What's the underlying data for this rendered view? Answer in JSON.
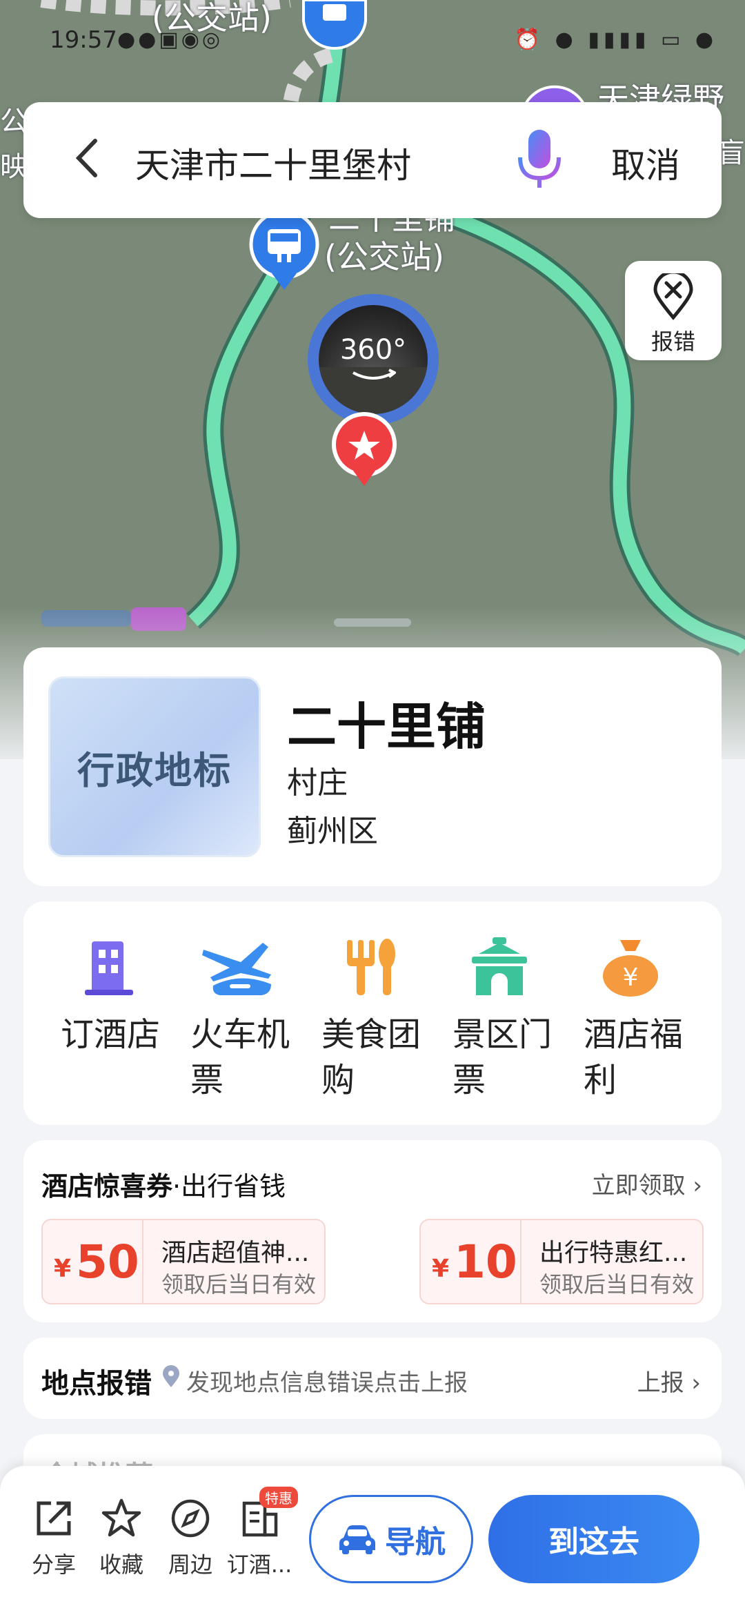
{
  "status_bar": {
    "time": "19:57"
  },
  "map": {
    "labels": [
      {
        "id": "top-bus-stop",
        "text": "(公交站)"
      },
      {
        "id": "bus-stop-name",
        "text": "二十里铺"
      },
      {
        "id": "bus-stop-type",
        "text": "(公交站)"
      },
      {
        "id": "right-poi",
        "text": "天津绿野"
      },
      {
        "id": "left-poi",
        "text": "公"
      },
      {
        "id": "left-poi-2",
        "text": "映"
      },
      {
        "id": "right-poi-2",
        "text": "盲"
      }
    ],
    "panorama_label": "360°"
  },
  "search": {
    "query": "天津市二十里堡村",
    "cancel_label": "取消"
  },
  "report_float": {
    "label": "报错"
  },
  "place": {
    "thumbnail_text": "行政地标",
    "name": "二十里铺",
    "type": "村庄",
    "district": "蓟州区"
  },
  "services": [
    {
      "icon": "hotel-building-icon",
      "label": "订酒店",
      "color": "#7b6cf0"
    },
    {
      "icon": "train-plane-icon",
      "label": "火车机票",
      "color": "#3a8ef0"
    },
    {
      "icon": "food-fork-spoon-icon",
      "label": "美食团购",
      "color": "#f5a23a"
    },
    {
      "icon": "scenic-gate-icon",
      "label": "景区门票",
      "color": "#3cc39a"
    },
    {
      "icon": "money-bag-icon",
      "label": "酒店福利",
      "color": "#f28a2e"
    }
  ],
  "coupons": {
    "title": "酒店惊喜券",
    "subtitle": "·出行省钱",
    "more_label": "立即领取 ›",
    "items": [
      {
        "currency": "¥",
        "amount": "50",
        "title": "酒店超值神...",
        "desc": "领取后当日有效"
      },
      {
        "currency": "¥",
        "amount": "10",
        "title": "出行特惠红...",
        "desc": "领取后当日有效"
      }
    ]
  },
  "location_report": {
    "title": "地点报错",
    "hint": "发现地点信息错误点击上报",
    "action_label": "上报 ›"
  },
  "next_section": {
    "title": "全城推荐"
  },
  "bottom_bar": {
    "items": [
      {
        "icon": "share-icon",
        "label": "分享"
      },
      {
        "icon": "star-icon",
        "label": "收藏"
      },
      {
        "icon": "compass-icon",
        "label": "周边"
      },
      {
        "icon": "hotel-booking-icon",
        "label": "订酒..."
      }
    ],
    "promo_tag": "特惠",
    "navigate_label": "导航",
    "go_label": "到这去"
  },
  "colors": {
    "accent": "#2f6fdf",
    "map_bg": "#7b8a78",
    "route": "#5ed8a4",
    "coupon_red": "#e8412c"
  }
}
